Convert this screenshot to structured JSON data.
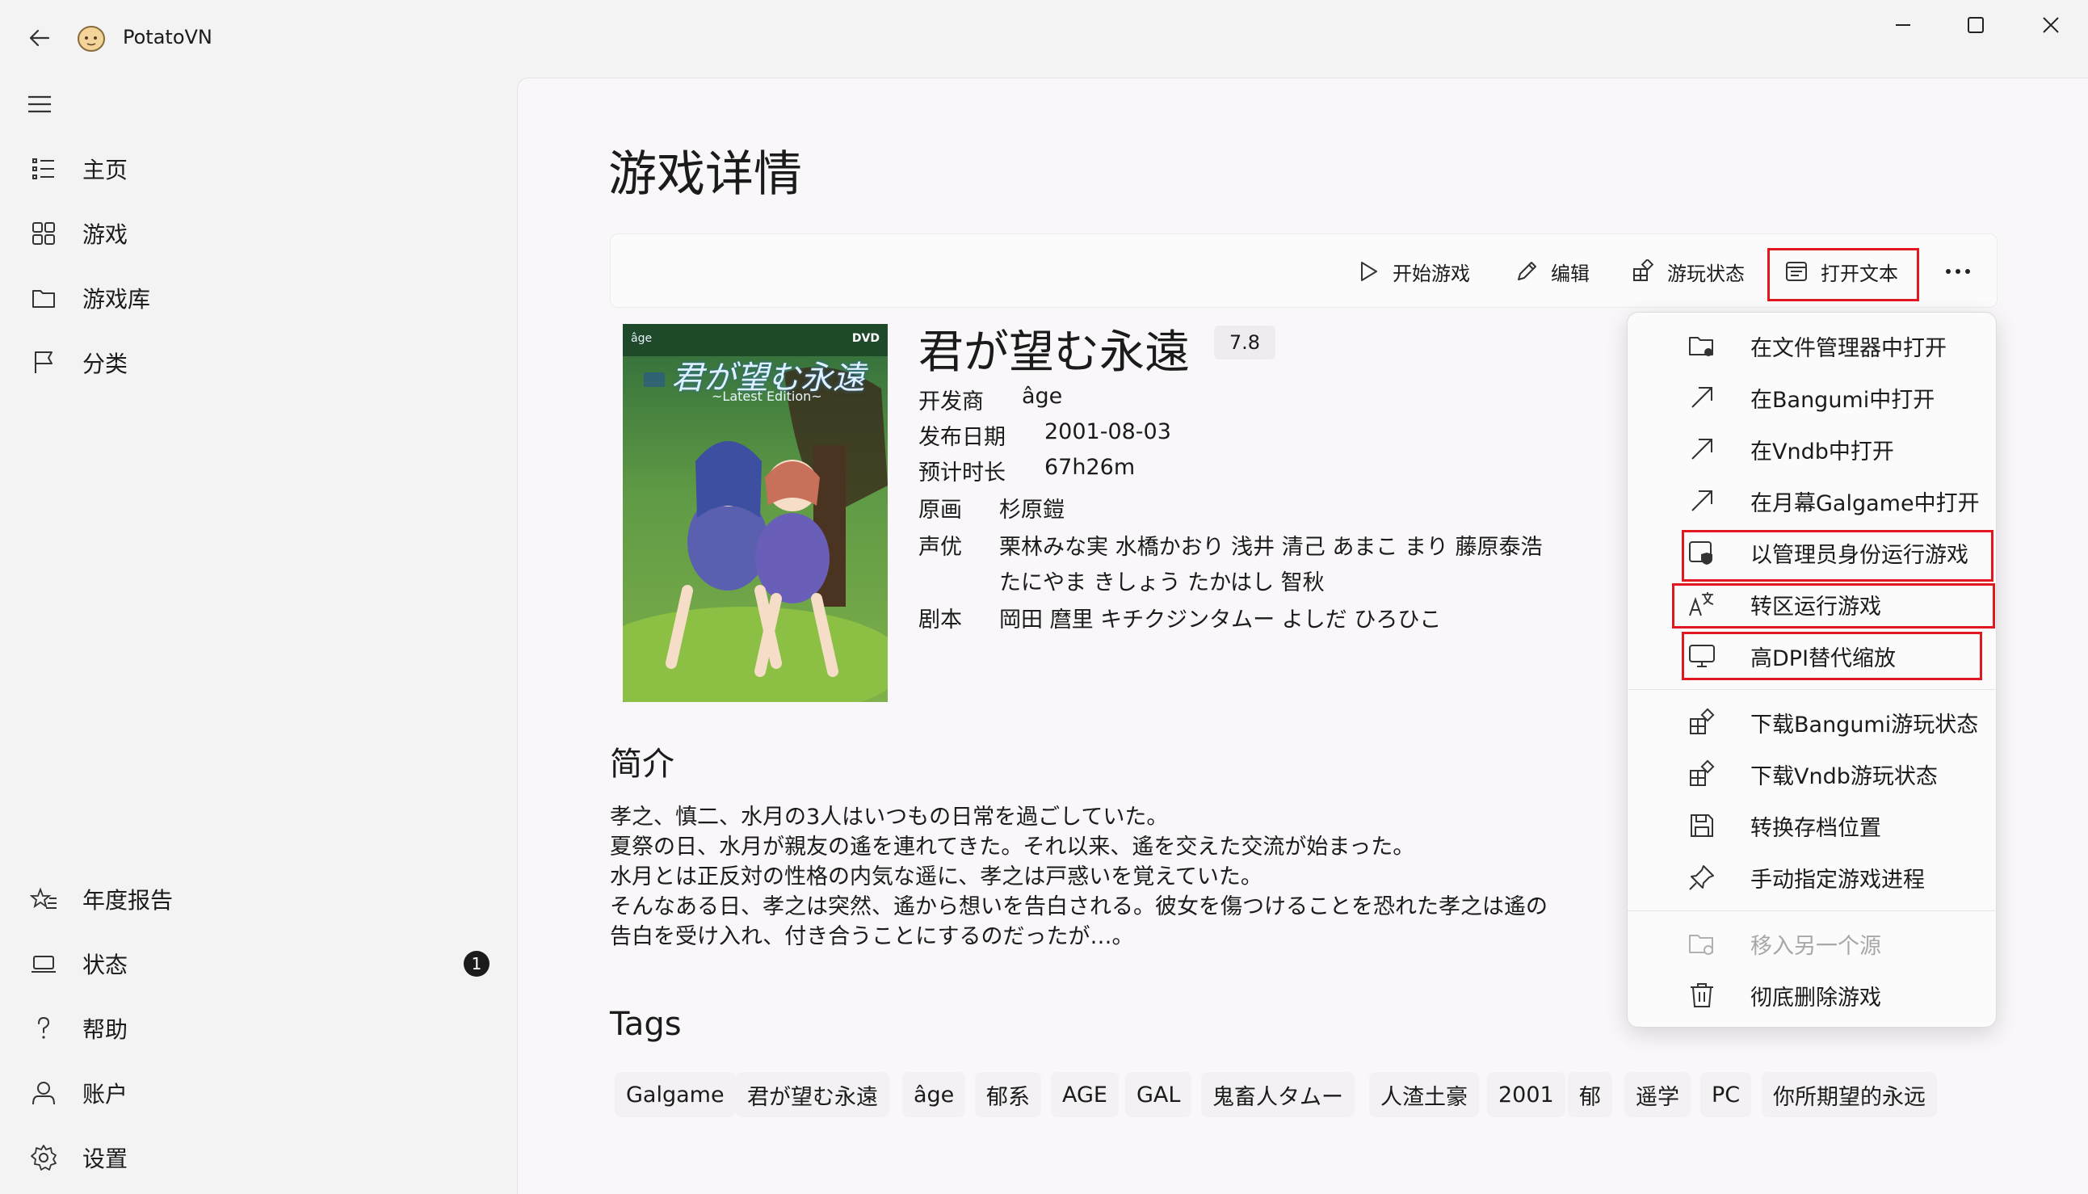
{
  "app": {
    "title": "PotatoVN"
  },
  "nav": {
    "items": [
      {
        "label": "主页",
        "icon": "home-list-icon"
      },
      {
        "label": "游戏",
        "icon": "grid-icon"
      },
      {
        "label": "游戏库",
        "icon": "folder-icon"
      },
      {
        "label": "分类",
        "icon": "flag-icon"
      }
    ],
    "footer": [
      {
        "label": "年度报告",
        "icon": "star-list-icon"
      },
      {
        "label": "状态",
        "icon": "laptop-icon",
        "badge": "1"
      },
      {
        "label": "帮助",
        "icon": "question-icon"
      },
      {
        "label": "账户",
        "icon": "person-icon"
      },
      {
        "label": "设置",
        "icon": "gear-icon"
      }
    ]
  },
  "page": {
    "title": "游戏详情"
  },
  "toolbar": {
    "start": "开始游戏",
    "edit": "编辑",
    "play_status": "游玩状态",
    "open_text": "打开文本"
  },
  "game": {
    "title": "君が望む永遠",
    "score": "7.8",
    "developer_label": "开发商",
    "developer": "âge",
    "release_label": "发布日期",
    "release": "2001-08-03",
    "duration_label": "预计时长",
    "duration": "67h26m",
    "artist_label": "原画",
    "artist": "杉原鎧",
    "cv_label": "声优",
    "cv_line1": "栗林みな実 水橋かおり 浅井 清己 あまこ まり 藤原泰浩",
    "cv_line2": "たにやま きしょう たかはし 智秋",
    "writer_label": "剧本",
    "writer": "岡田 麿里 キチクジンタムー よしだ ひろひこ"
  },
  "cover": {
    "logo_text": "君が望む永遠",
    "logo_sub": "~Latest Edition~",
    "dvd": "DVD",
    "brand": "âge"
  },
  "intro": {
    "heading": "简介",
    "lines": [
      "孝之、慎二、水月の3人はいつもの日常を過ごしていた。",
      "夏祭の日、水月が親友の遙を連れてきた。それ以来、遙を交えた交流が始まった。",
      "水月とは正反対の性格の内気な遥に、孝之は戸惑いを覚えていた。",
      "そんなある日、孝之は突然、遙から想いを告白される。彼女を傷つけることを恐れた孝之は遙の",
      "告白を受け入れ、付き合うことにするのだったが…。"
    ]
  },
  "tags": {
    "heading": "Tags",
    "items": [
      "Galgame",
      "君が望む永遠",
      "âge",
      "郁系",
      "AGE",
      "GAL",
      "鬼畜人タムー",
      "人渣土豪",
      "2001",
      "郁",
      "遥学",
      "PC",
      "你所期望的永远"
    ]
  },
  "menu": {
    "items": [
      {
        "label": "在文件管理器中打开",
        "icon": "folder-open-icon"
      },
      {
        "label": "在Bangumi中打开",
        "icon": "arrow-up-right-icon"
      },
      {
        "label": "在Vndb中打开",
        "icon": "arrow-up-right-icon"
      },
      {
        "label": "在月幕Galgame中打开",
        "icon": "arrow-up-right-icon"
      },
      {
        "label": "以管理员身份运行游戏",
        "icon": "shield-window-icon"
      },
      {
        "label": "转区运行游戏",
        "icon": "translate-icon"
      },
      {
        "label": "高DPI替代缩放",
        "icon": "monitor-icon"
      },
      {
        "label": "下载Bangumi游玩状态",
        "icon": "apps-add-icon"
      },
      {
        "label": "下载Vndb游玩状态",
        "icon": "apps-add-icon"
      },
      {
        "label": "转换存档位置",
        "icon": "save-icon"
      },
      {
        "label": "手动指定游戏进程",
        "icon": "pin-icon"
      },
      {
        "label": "移入另一个源",
        "icon": "folder-move-icon",
        "disabled": true
      },
      {
        "label": "彻底删除游戏",
        "icon": "trash-icon"
      }
    ]
  },
  "highlight_color": "#e0181f"
}
